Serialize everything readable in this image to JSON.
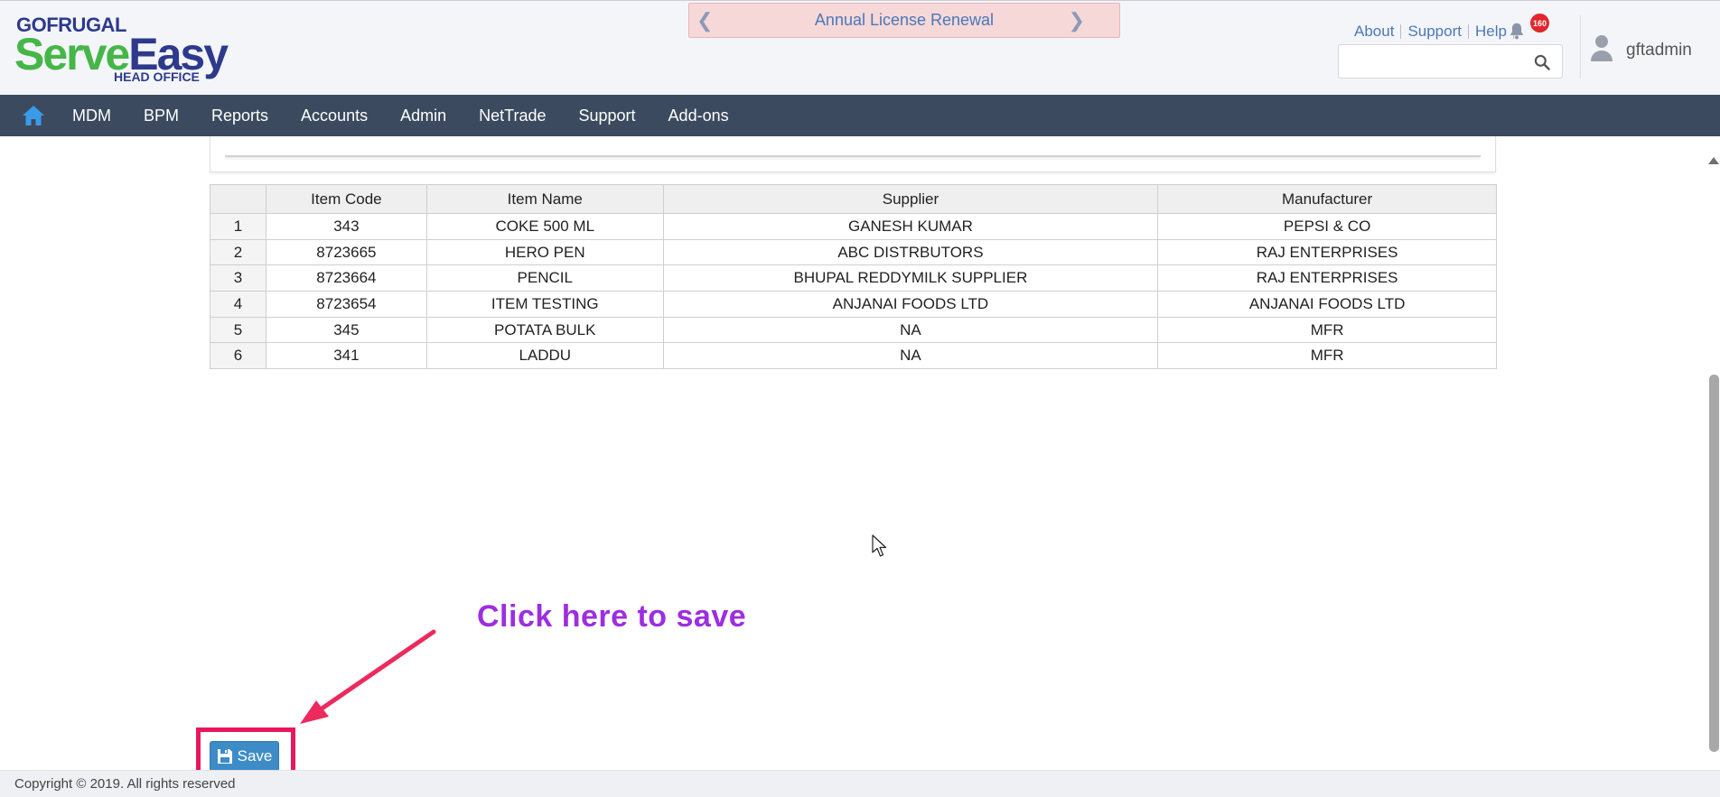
{
  "header": {
    "logo": {
      "brand": "GOFRUGAL",
      "product_part1": "Serve",
      "product_part2": "Easy",
      "subtitle": "HEAD OFFICE"
    },
    "banner": {
      "text": "Annual License Renewal"
    },
    "links": {
      "about": "About",
      "support": "Support",
      "help": "Help"
    },
    "notifications": {
      "count": "160"
    },
    "search": {
      "value": "",
      "placeholder": ""
    },
    "user": {
      "name": "gftadmin"
    }
  },
  "nav": {
    "items": [
      "MDM",
      "BPM",
      "Reports",
      "Accounts",
      "Admin",
      "NetTrade",
      "Support",
      "Add-ons"
    ]
  },
  "table": {
    "columns": [
      "",
      "Item Code",
      "Item Name",
      "Supplier",
      "Manufacturer"
    ],
    "rows": [
      [
        "1",
        "343",
        "COKE 500 ML",
        "GANESH KUMAR",
        "PEPSI & CO"
      ],
      [
        "2",
        "8723665",
        "HERO PEN",
        "ABC DISTRBUTORS",
        "RAJ ENTERPRISES"
      ],
      [
        "3",
        "8723664",
        "PENCIL",
        "BHUPAL REDDYMILK SUPPLIER",
        "RAJ ENTERPRISES"
      ],
      [
        "4",
        "8723654",
        "ITEM TESTING",
        "ANJANAI FOODS LTD",
        "ANJANAI FOODS LTD"
      ],
      [
        "5",
        "345",
        "POTATA BULK",
        "NA",
        "MFR"
      ],
      [
        "6",
        "341",
        "LADDU",
        "NA",
        "MFR"
      ]
    ]
  },
  "annotation": {
    "text": "Click here to save",
    "color": "#9d2ee0",
    "highlight_color": "#e8185b"
  },
  "actions": {
    "save_label": "Save"
  },
  "footer": {
    "copyright": "Copyright © 2019. All rights reserved"
  },
  "colors": {
    "nav_bg": "#3b4a5e",
    "accent": "#3d8cc8",
    "banner_bg": "#f6d8d8"
  }
}
